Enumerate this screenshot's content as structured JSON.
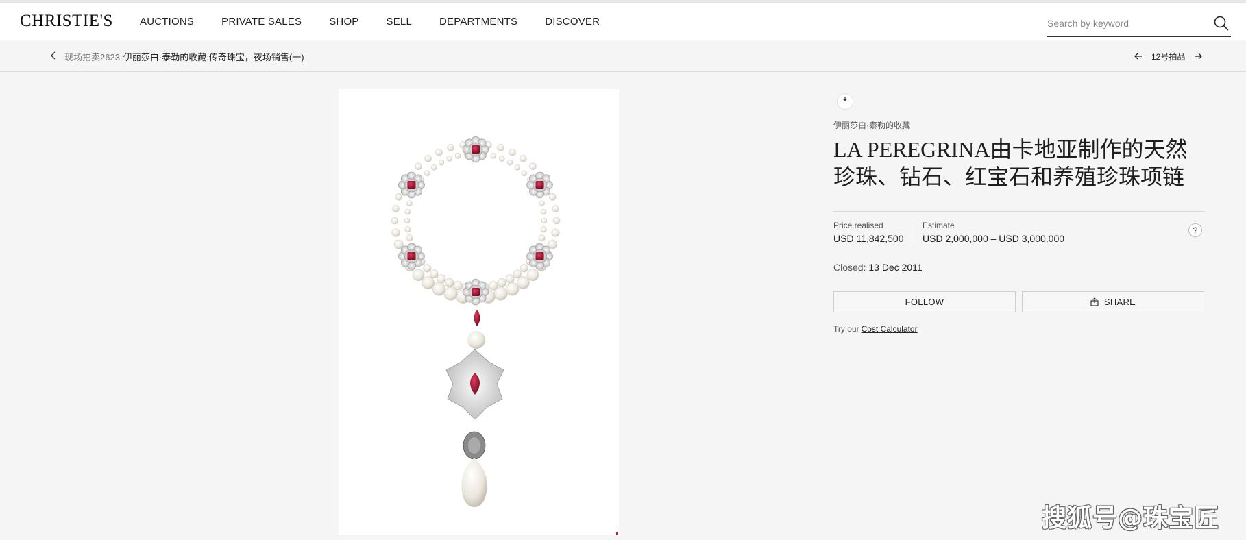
{
  "header": {
    "logo": "CHRISTIE'S",
    "nav": [
      "AUCTIONS",
      "PRIVATE SALES",
      "SHOP",
      "SELL",
      "DEPARTMENTS",
      "DISCOVER"
    ],
    "search_placeholder": "Search by keyword"
  },
  "subbar": {
    "sale_number": "现场拍卖2623",
    "sale_title": "伊丽莎白·泰勒的收藏:传奇珠宝，夜场销售(一)",
    "lot_label": "12号拍品"
  },
  "lot": {
    "badge": "*",
    "collection": "伊丽莎白·泰勒的收藏",
    "title": "LA PEREGRINA由卡地亚制作的天然珍珠、钻石、红宝石和养殖珍珠项链",
    "price_label": "Price realised",
    "price_value": "USD 11,842,500",
    "estimate_label": "Estimate",
    "estimate_value": "USD 2,000,000 – USD 3,000,000",
    "help": "?",
    "closed_label": "Closed:",
    "closed_date": "13 Dec 2011",
    "follow_label": "FOLLOW",
    "share_label": "SHARE",
    "calc_prefix": "Try our",
    "calc_link": "Cost Calculator"
  },
  "watermark": "搜狐号@珠宝匠",
  "colors": {
    "background": "#f5f5f5",
    "header": "#ffffff",
    "ruby": "#b0173a",
    "pearl": "#ece7df"
  },
  "icons": [
    "search-icon",
    "chevron-left-icon",
    "arrow-left-icon",
    "arrow-right-icon",
    "share-icon"
  ]
}
